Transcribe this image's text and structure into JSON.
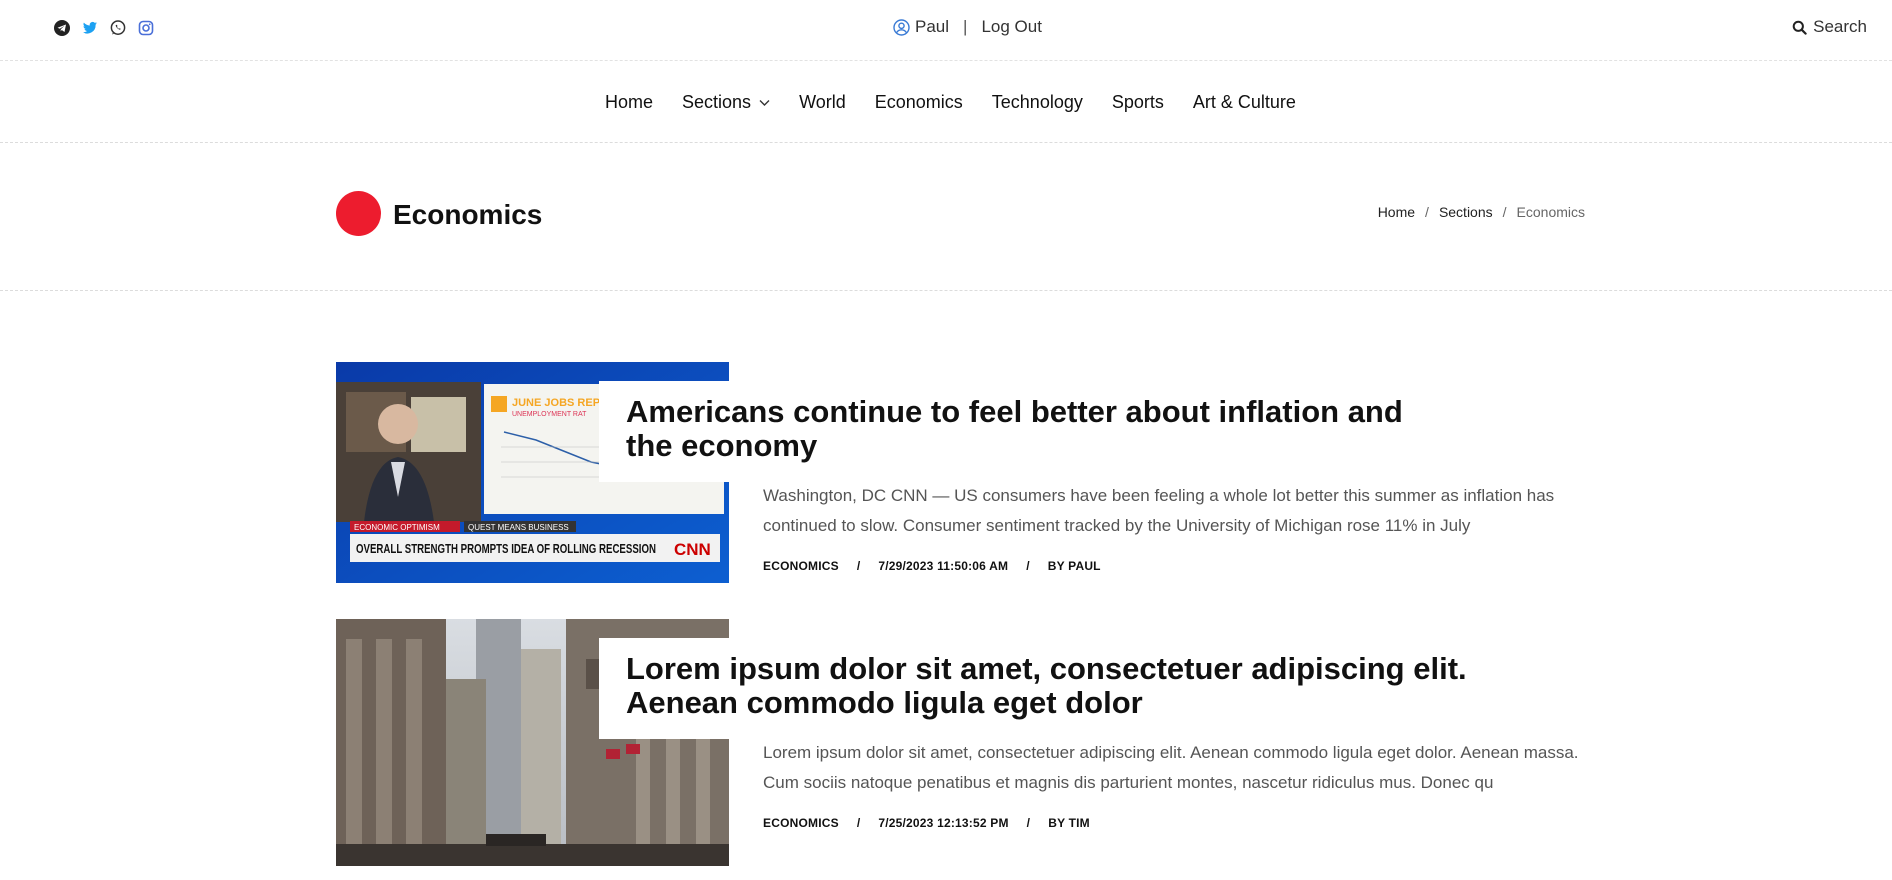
{
  "topbar": {
    "social_icons": [
      "telegram-icon",
      "twitter-icon",
      "whatsapp-icon",
      "instagram-icon"
    ],
    "user_name": "Paul",
    "separator": "|",
    "logout_label": "Log Out",
    "search_label": "Search"
  },
  "nav": {
    "items": [
      {
        "label": "Home"
      },
      {
        "label": "Sections"
      },
      {
        "label": "World"
      },
      {
        "label": "Economics"
      },
      {
        "label": "Technology"
      },
      {
        "label": "Sports"
      },
      {
        "label": "Art & Culture"
      }
    ]
  },
  "page": {
    "title": "Economics",
    "accent_color": "#ed1c2e",
    "breadcrumb": [
      "Home",
      "Sections",
      "Economics"
    ],
    "crumb_separator": "/"
  },
  "articles": [
    {
      "title": "Americans continue to feel better about inflation and the economy",
      "excerpt": "Washington, DC CNN — US consumers have been feeling a whole lot better this summer as inflation has continued to slow. Consumer sentiment tracked by the University of Michigan rose 11% in July",
      "category": "ECONOMICS",
      "date": "7/29/2023 11:50:06 AM",
      "author": "BY PAUL",
      "image": {
        "tag1": "ECONOMIC OPTIMISM",
        "tag2": "QUEST MEANS BUSINESS",
        "headline": "OVERALL STRENGTH PROMPTS IDEA OF ROLLING RECESSION",
        "logo": "CNN",
        "chart_title": "JUNE JOBS REP",
        "chart_sub": "UNEMPLOYMENT RAT"
      }
    },
    {
      "title": "Lorem ipsum dolor sit amet, consectetuer adipiscing elit. Aenean commodo ligula eget dolor",
      "excerpt": "Lorem ipsum dolor sit amet, consectetuer adipiscing elit. Aenean commodo ligula eget dolor. Aenean massa. Cum sociis natoque penatibus et magnis dis parturient montes, nascetur ridiculus mus. Donec qu",
      "category": "ECONOMICS",
      "date": "7/25/2023 12:13:52 PM",
      "author": "BY TIM"
    }
  ],
  "meta_separator": "/"
}
